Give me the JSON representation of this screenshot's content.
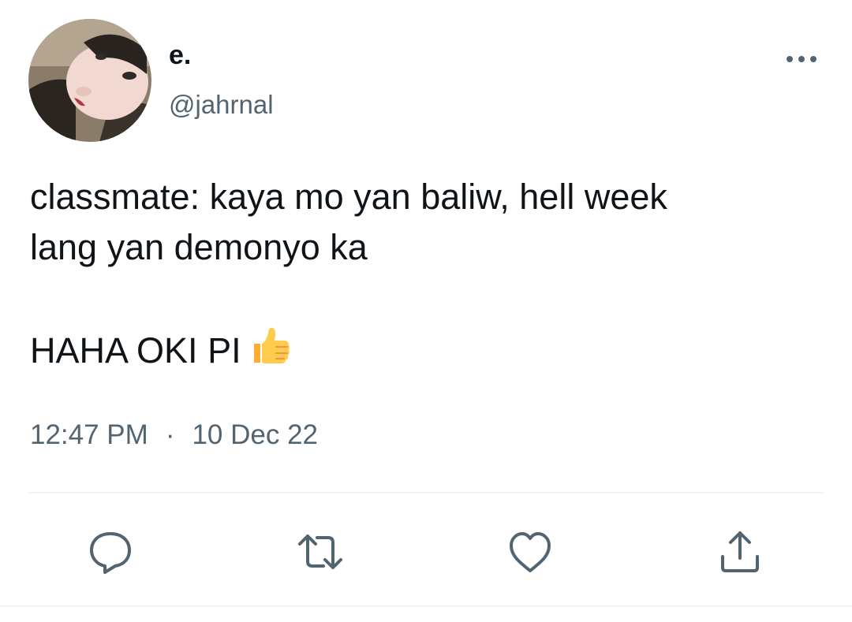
{
  "tweet": {
    "display_name": "e.",
    "handle": "@jahrnal",
    "text_line1": "classmate: kaya mo yan baliw, hell week\nlang yan demonyo ka",
    "text_line2": "HAHA OKI PI",
    "emoji": "thumbs-up-emoji",
    "time": "12:47 PM",
    "separator": "·",
    "date": "10 Dec 22"
  },
  "icons": {
    "more": "more-icon",
    "reply": "reply-icon",
    "retweet": "retweet-icon",
    "like": "heart-icon",
    "share": "share-icon"
  },
  "colors": {
    "text": "#0f1419",
    "secondary": "#536471",
    "divider": "#eff3f4",
    "emoji": "#ffcc4d"
  }
}
